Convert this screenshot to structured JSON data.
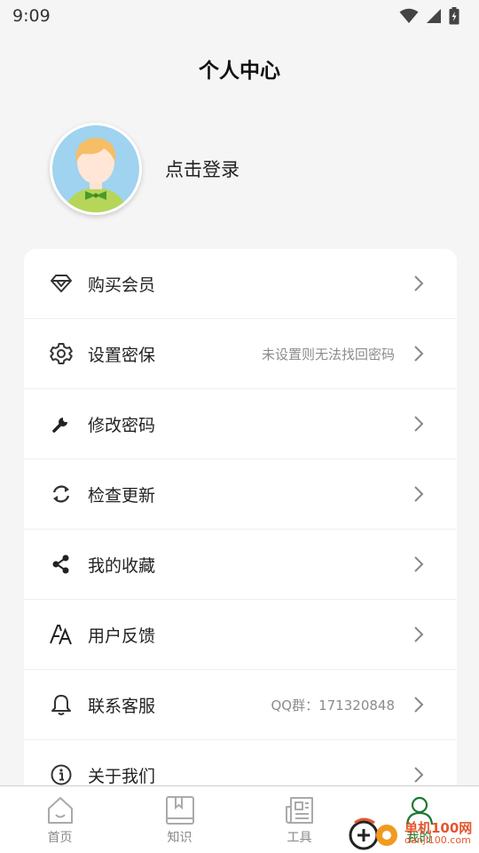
{
  "status_bar": {
    "time": "9:09"
  },
  "header": {
    "title": "个人中心"
  },
  "profile": {
    "login_text": "点击登录"
  },
  "menu": {
    "items": [
      {
        "label": "购买会员",
        "hint": "",
        "icon": "diamond-icon"
      },
      {
        "label": "设置密保",
        "hint": "未设置则无法找回密码",
        "icon": "gear-icon"
      },
      {
        "label": "修改密码",
        "hint": "",
        "icon": "wrench-icon"
      },
      {
        "label": "检查更新",
        "hint": "",
        "icon": "refresh-icon"
      },
      {
        "label": "我的收藏",
        "hint": "",
        "icon": "share-icon"
      },
      {
        "label": "用户反馈",
        "hint": "",
        "icon": "font-icon"
      },
      {
        "label": "联系客服",
        "hint": "QQ群：171320848",
        "icon": "bell-icon"
      },
      {
        "label": "关于我们",
        "hint": "",
        "icon": "info-icon"
      }
    ]
  },
  "bottom_nav": {
    "items": [
      {
        "label": "首页",
        "icon": "home-icon"
      },
      {
        "label": "知识",
        "icon": "book-icon"
      },
      {
        "label": "工具",
        "icon": "newspaper-icon"
      },
      {
        "label": "我的",
        "icon": "person-icon"
      }
    ],
    "active_index": 3
  },
  "watermark": {
    "name": "单机100网",
    "url": "danji100.com"
  },
  "colors": {
    "accent": "#1a7a2e",
    "background": "#f5f5f5"
  }
}
